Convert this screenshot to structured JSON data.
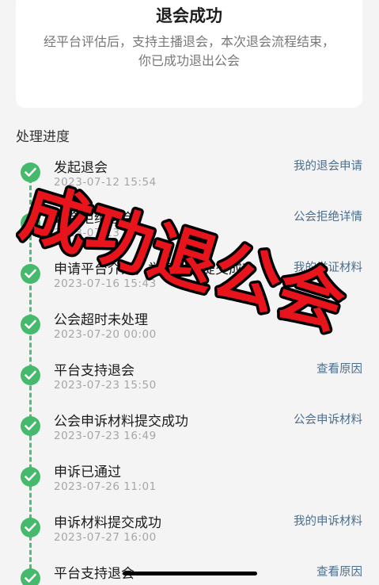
{
  "result": {
    "title": "退会成功",
    "description": "经平台评估后，支持主播退会，本次退会流程结束，你已成功退出公会"
  },
  "progress": {
    "section_title": "处理进度",
    "steps": [
      {
        "title": "发起退会",
        "time": "2023-07-12 15:54",
        "link": "我的退会申请"
      },
      {
        "title": "公会拒绝退会",
        "time": "2023-07-13 10:20",
        "link": "公会拒绝详情"
      },
      {
        "title": "申请平台介入，举证材料提交成功",
        "time": "2023-07-16 15:43",
        "link": "我的举证材料"
      },
      {
        "title": "公会超时未处理",
        "time": "2023-07-20 00:00",
        "link": ""
      },
      {
        "title": "平台支持退会",
        "time": "2023-07-23 15:50",
        "link": "查看原因"
      },
      {
        "title": "公会申诉材料提交成功",
        "time": "2023-07-23 16:49",
        "link": "公会申诉材料"
      },
      {
        "title": "申诉已通过",
        "time": "2023-07-26 11:01",
        "link": ""
      },
      {
        "title": "申诉材料提交成功",
        "time": "2023-07-27 16:00",
        "link": "我的申诉材料"
      },
      {
        "title": "平台支持退会",
        "time": "",
        "link": "查看原因"
      }
    ]
  },
  "overlay": {
    "stamp_text": "成功退公会",
    "fill_color": "#e8141c",
    "outline_color": "#000000"
  },
  "colors": {
    "accent_green": "#45b96c",
    "link_blue": "#4d6d8c"
  }
}
